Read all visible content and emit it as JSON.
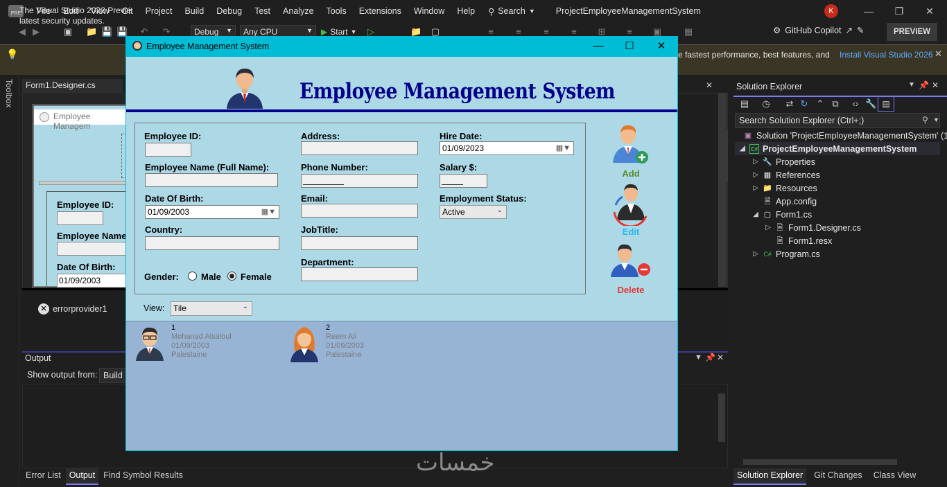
{
  "menu": {
    "items": [
      "File",
      "Edit",
      "View",
      "Git",
      "Project",
      "Build",
      "Debug",
      "Test",
      "Analyze",
      "Tools",
      "Extensions",
      "Window",
      "Help"
    ],
    "search": "Search",
    "project_title": "ProjectEmployeeManagementSystem",
    "avatar_initial": "K",
    "logo_text": "PRE"
  },
  "toolbar": {
    "config": "Debug",
    "platform": "Any CPU",
    "start": "Start",
    "copilot": "GitHub Copilot",
    "preview": "PREVIEW"
  },
  "infobar": {
    "text_left": "The Visual Studio 2022 Previe",
    "text_left_line2": "latest security updates.",
    "text_right": "e fastest performance, best features, and",
    "link": "Install Visual Studio 2026"
  },
  "sidebar": {
    "toolbox": "Toolbox"
  },
  "designer": {
    "tab": "Form1.Designer.cs",
    "form_title": "Employee Managem",
    "labels": [
      "Employee ID:",
      "Employee Name",
      "Date Of Birth:"
    ],
    "dob_value": "01/09/2003",
    "errorprovider": "errorprovider1"
  },
  "output": {
    "title": "Output",
    "show_from": "Show output from:",
    "source": "Build",
    "tabs": [
      "Error List",
      "Output",
      "Find Symbol Results"
    ]
  },
  "solution_explorer": {
    "title": "Solution Explorer",
    "search_placeholder": "Search Solution Explorer (Ctrl+;)",
    "tree": [
      {
        "label": "Solution 'ProjectEmployeeManagementSystem' (1"
      },
      {
        "label": "ProjectEmployeeManagementSystem"
      },
      {
        "label": "Properties"
      },
      {
        "label": "References"
      },
      {
        "label": "Resources"
      },
      {
        "label": "App.config"
      },
      {
        "label": "Form1.cs"
      },
      {
        "label": "Form1.Designer.cs"
      },
      {
        "label": "Form1.resx"
      },
      {
        "label": "Program.cs"
      }
    ],
    "tabs": [
      "Solution Explorer",
      "Git Changes",
      "Class View"
    ]
  },
  "app": {
    "window_title": "Employee Management System",
    "header": "Employee Management System",
    "fields": {
      "employee_id": "Employee ID:",
      "employee_name": "Employee Name (Full Name):",
      "dob": "Date Of Birth:",
      "dob_value": "01/09/2003",
      "country": "Country:",
      "gender": "Gender:",
      "male": "Male",
      "female": "Female",
      "address": "Address:",
      "phone": "Phone Number:",
      "email": "Email:",
      "jobtitle": "JobTitle:",
      "department": "Department:",
      "hire_date": "Hire Date:",
      "hire_value": "01/09/2023",
      "salary": "Salary $:",
      "status": "Employment Status:",
      "status_value": "Active"
    },
    "actions": {
      "add": "Add",
      "edit": "Edit",
      "delete": "Delete"
    },
    "view": {
      "label": "View:",
      "value": "Tile"
    },
    "employees": [
      {
        "id": "1",
        "name": "Mohanad Alsaloul",
        "dob": "01/09/2003",
        "country": "Palestaine"
      },
      {
        "id": "2",
        "name": "Reem Ali",
        "dob": "01/09/2003",
        "country": "Palestaine"
      }
    ],
    "colors": {
      "title_bar": "#00bcd4",
      "form_bg": "#add8e6",
      "header_text": "#00008b",
      "add": "#5a8a2a",
      "edit": "#29b6f6",
      "delete": "#e53935"
    }
  },
  "watermark": "خمسات"
}
